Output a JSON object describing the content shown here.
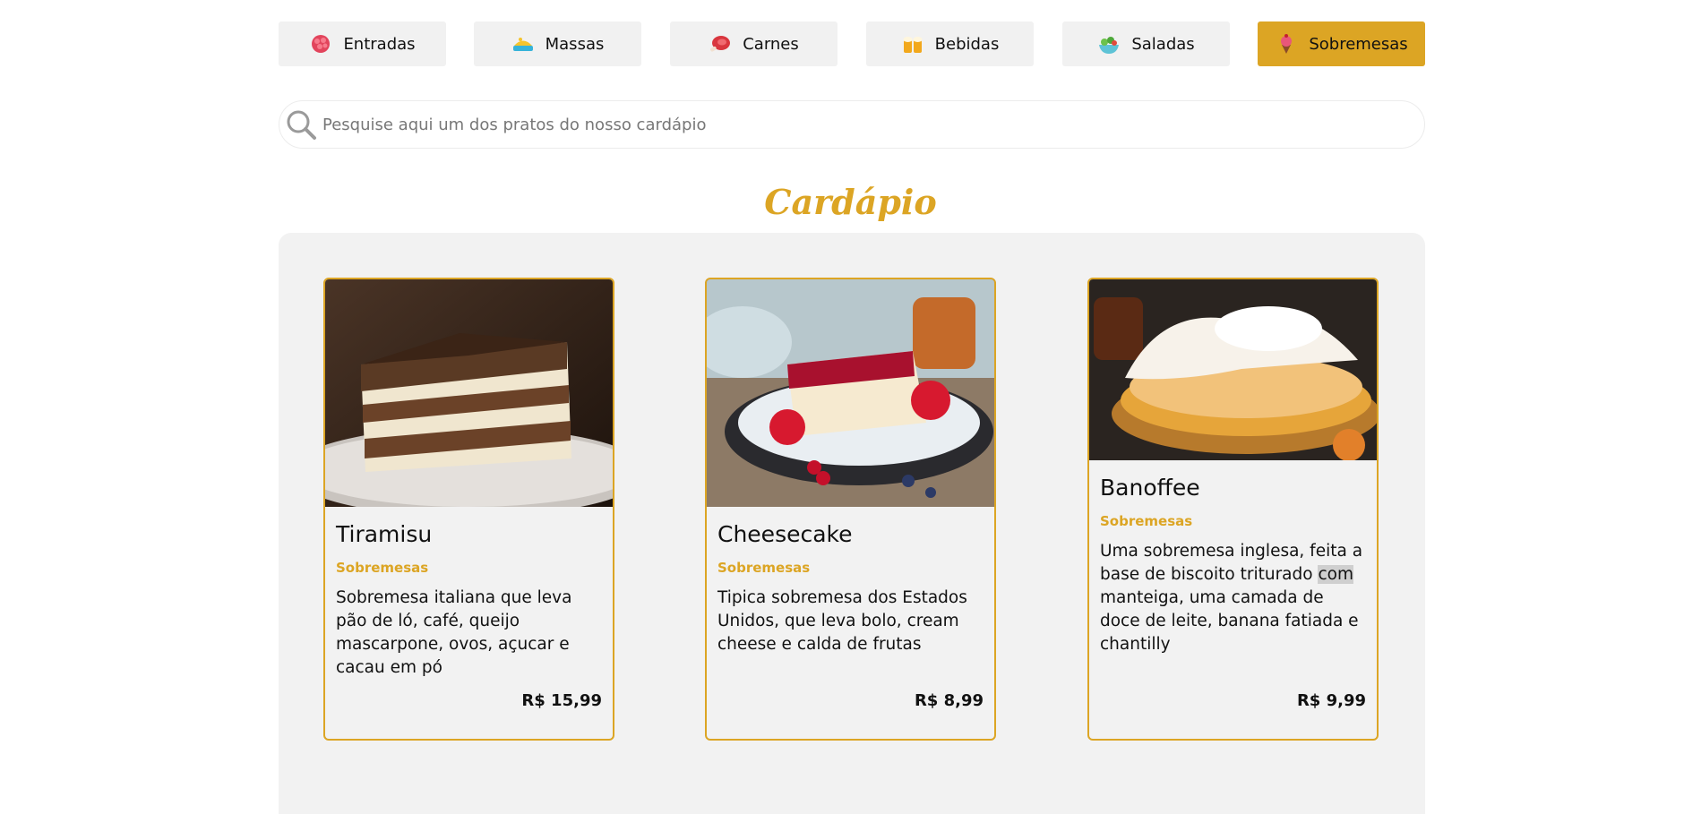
{
  "categories": [
    {
      "label": "Entradas",
      "icon": "appetizer-icon",
      "active": false
    },
    {
      "label": "Massas",
      "icon": "pasta-icon",
      "active": false
    },
    {
      "label": "Carnes",
      "icon": "meat-icon",
      "active": false
    },
    {
      "label": "Bebidas",
      "icon": "drinks-icon",
      "active": false
    },
    {
      "label": "Saladas",
      "icon": "salad-icon",
      "active": false
    },
    {
      "label": "Sobremesas",
      "icon": "dessert-icon",
      "active": true
    }
  ],
  "search": {
    "placeholder": "Pesquise aqui um dos pratos do nosso cardápio",
    "value": ""
  },
  "section_title": "Cardápio",
  "items": [
    {
      "name": "Tiramisu",
      "category": "Sobremesas",
      "description": "Sobremesa italiana que leva pão de ló, café, queijo mascarpone, ovos, açucar e cacau em pó",
      "price": "R$ 15,99"
    },
    {
      "name": "Cheesecake",
      "category": "Sobremesas",
      "description": "Tipica sobremesa dos Estados Unidos, que leva bolo, cream cheese e calda de frutas",
      "price": "R$ 8,99"
    },
    {
      "name": "Banoffee",
      "category": "Sobremesas",
      "description_before": "Uma sobremesa inglesa, feita a base de biscoito triturado ",
      "description_highlight": "com",
      "description_after": " manteiga, uma camada de doce de leite, banana fatiada e chantilly",
      "price": "R$ 9,99"
    }
  ],
  "colors": {
    "accent": "#dca524",
    "button_bg": "#f1f1f1",
    "panel_bg": "#f2f2f2"
  }
}
